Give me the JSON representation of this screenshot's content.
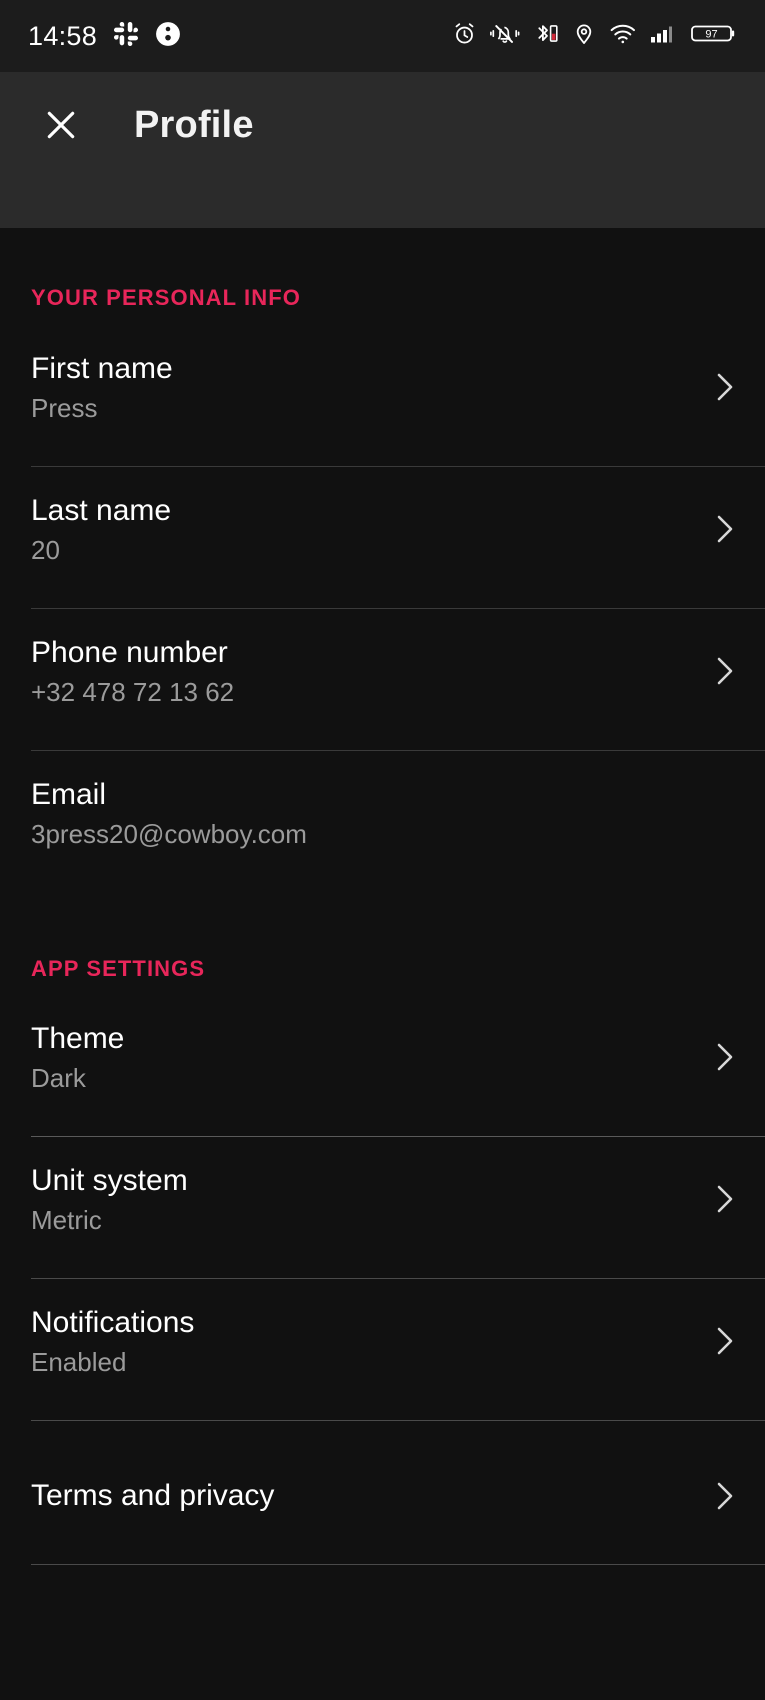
{
  "statusbar": {
    "time": "14:58",
    "left_icons": [
      "slack-icon",
      "info-circle-icon"
    ],
    "right_icons": [
      "alarm-icon",
      "vibrate-mute-icon",
      "bluetooth-battery-icon",
      "location-pin-icon",
      "wifi-icon",
      "cellular-signal-icon",
      "battery-icon"
    ],
    "battery_level": "97"
  },
  "appbar": {
    "close_label": "close-icon",
    "title": "Profile"
  },
  "colors": {
    "accent": "#e8265a",
    "background": "#111111",
    "appbar_background": "#2b2b2b",
    "statusbar_background": "#1c1c1c",
    "label": "#ffffff",
    "value": "#9b9b9b",
    "divider": "#4a4a4a"
  },
  "sections": [
    {
      "title": "YOUR PERSONAL INFO",
      "rows": [
        {
          "label": "First name",
          "value": "Press",
          "chevron": true
        },
        {
          "label": "Last name",
          "value": "20",
          "chevron": true
        },
        {
          "label": "Phone number",
          "value": "+32 478 72 13 62",
          "chevron": true
        },
        {
          "label": "Email",
          "value": "3press20@cowboy.com",
          "chevron": false
        }
      ]
    },
    {
      "title": "APP SETTINGS",
      "rows": [
        {
          "label": "Theme",
          "value": "Dark",
          "chevron": true
        },
        {
          "label": "Unit system",
          "value": "Metric",
          "chevron": true
        },
        {
          "label": "Notifications",
          "value": "Enabled",
          "chevron": true
        },
        {
          "label": "Terms and privacy",
          "value": "",
          "chevron": true
        }
      ]
    }
  ]
}
